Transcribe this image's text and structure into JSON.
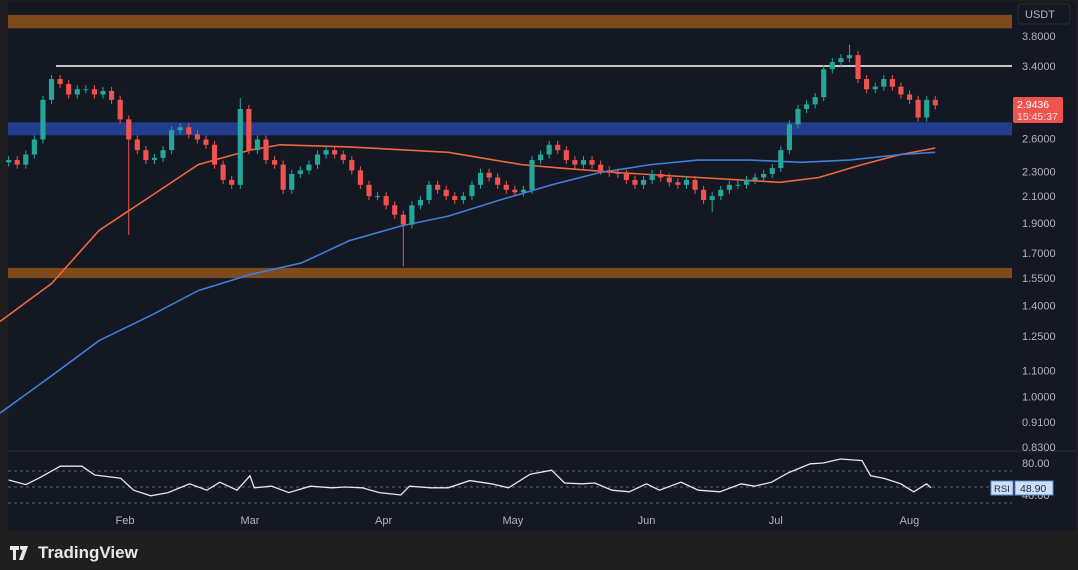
{
  "chart_data": {
    "type": "candlestick",
    "quote_currency": "USDT",
    "price_scale": "log",
    "ylim": [
      0.8,
      4.3
    ],
    "y_ticks": [
      "3.8000",
      "3.4000",
      "2.6000",
      "2.3000",
      "2.1000",
      "1.9000",
      "1.7000",
      "1.5500",
      "1.4000",
      "1.2500",
      "1.1000",
      "1.0000",
      "0.9100",
      "0.8300"
    ],
    "x_ticks": [
      {
        "label": "Feb",
        "day": 29
      },
      {
        "label": "Mar",
        "day": 58
      },
      {
        "label": "Apr",
        "day": 89
      },
      {
        "label": "May",
        "day": 119
      },
      {
        "label": "Jun",
        "day": 150
      },
      {
        "label": "Jul",
        "day": 180
      },
      {
        "label": "Aug",
        "day": 211
      }
    ],
    "day_range": [
      0,
      216
    ],
    "closes": [
      2.4,
      2.36,
      2.45,
      2.59,
      3.0,
      3.24,
      3.18,
      3.06,
      3.12,
      3.12,
      3.06,
      3.1,
      3.0,
      2.79,
      2.59,
      2.49,
      2.4,
      2.42,
      2.49,
      2.68,
      2.71,
      2.64,
      2.59,
      2.54,
      2.36,
      2.23,
      2.19,
      2.9,
      2.49,
      2.59,
      2.4,
      2.36,
      2.15,
      2.28,
      2.31,
      2.36,
      2.45,
      2.49,
      2.45,
      2.4,
      2.31,
      2.19,
      2.1,
      2.1,
      2.03,
      1.96,
      1.89,
      2.03,
      2.07,
      2.19,
      2.15,
      2.1,
      2.07,
      2.1,
      2.19,
      2.29,
      2.25,
      2.19,
      2.15,
      2.13,
      2.15,
      2.4,
      2.45,
      2.54,
      2.49,
      2.4,
      2.36,
      2.4,
      2.36,
      2.31,
      2.29,
      2.28,
      2.23,
      2.19,
      2.23,
      2.28,
      2.25,
      2.21,
      2.19,
      2.23,
      2.15,
      2.07,
      2.1,
      2.15,
      2.19,
      2.19,
      2.23,
      2.25,
      2.28,
      2.33,
      2.49,
      2.74,
      2.9,
      2.95,
      3.03,
      3.36,
      3.45,
      3.5,
      3.54,
      3.24,
      3.12,
      3.15,
      3.24,
      3.15,
      3.06,
      3.0,
      2.81,
      3.0,
      2.94
    ],
    "first_open": 2.38,
    "special_lows": [
      {
        "index": 14,
        "low": 1.82
      },
      {
        "index": 46,
        "low": 1.62
      },
      {
        "index": 82,
        "low": 1.98
      }
    ],
    "special_highs": [
      {
        "index": 27,
        "high": 3.02
      },
      {
        "index": 98,
        "high": 3.68
      }
    ],
    "last_price": "2.9436",
    "countdown": "15:45:37",
    "moving_averages": [
      {
        "name": "MA (orange)",
        "color": "#f0683a",
        "points": [
          [
            0,
            1.32
          ],
          [
            12,
            1.52
          ],
          [
            23,
            1.85
          ],
          [
            35,
            2.1
          ],
          [
            46,
            2.36
          ],
          [
            58,
            2.49
          ],
          [
            65,
            2.54
          ],
          [
            81,
            2.52
          ],
          [
            104,
            2.47
          ],
          [
            121,
            2.36
          ],
          [
            130,
            2.33
          ],
          [
            144,
            2.29
          ],
          [
            162,
            2.25
          ],
          [
            181,
            2.21
          ],
          [
            190,
            2.25
          ],
          [
            200,
            2.36
          ],
          [
            209,
            2.45
          ],
          [
            217,
            2.51
          ]
        ]
      },
      {
        "name": "MA (blue)",
        "color": "#3d7fd9",
        "points": [
          [
            0,
            0.94
          ],
          [
            12,
            1.08
          ],
          [
            23,
            1.23
          ],
          [
            35,
            1.35
          ],
          [
            46,
            1.48
          ],
          [
            58,
            1.57
          ],
          [
            70,
            1.64
          ],
          [
            81,
            1.78
          ],
          [
            93,
            1.88
          ],
          [
            104,
            1.95
          ],
          [
            116,
            2.07
          ],
          [
            128,
            2.19
          ],
          [
            139,
            2.29
          ],
          [
            151,
            2.36
          ],
          [
            162,
            2.4
          ],
          [
            174,
            2.4
          ],
          [
            186,
            2.38
          ],
          [
            197,
            2.4
          ],
          [
            209,
            2.45
          ],
          [
            217,
            2.47
          ]
        ]
      }
    ],
    "zones": [
      {
        "name": "resistance-zone-top",
        "color": "#8a4f1c",
        "from": 3.91,
        "to": 4.11
      },
      {
        "name": "support-zone-blue",
        "color": "#23409a",
        "from": 2.63,
        "to": 2.76
      },
      {
        "name": "support-zone-bottom",
        "color": "#8a4f1c",
        "from": 1.55,
        "to": 1.61
      }
    ],
    "horizontal_line": {
      "price": 3.4,
      "start_day": 13,
      "color": "#ffffff"
    },
    "rsi": {
      "label": "RSI",
      "value": "48.90",
      "levels": [
        70,
        50,
        30
      ],
      "tick_labels": [
        "80.00",
        "40.00"
      ],
      "points": [
        [
          2,
          58.8
        ],
        [
          6,
          53
        ],
        [
          9,
          61
        ],
        [
          14,
          76
        ],
        [
          19,
          76
        ],
        [
          22,
          65
        ],
        [
          28,
          61
        ],
        [
          31,
          46
        ],
        [
          35,
          39
        ],
        [
          39,
          43
        ],
        [
          44,
          54
        ],
        [
          48,
          46
        ],
        [
          51,
          56
        ],
        [
          55,
          46
        ],
        [
          58,
          64
        ],
        [
          59,
          49
        ],
        [
          63,
          51
        ],
        [
          67,
          43
        ],
        [
          72,
          51
        ],
        [
          77,
          49
        ],
        [
          80,
          50
        ],
        [
          84,
          49
        ],
        [
          88,
          43
        ],
        [
          93,
          40
        ],
        [
          95,
          51
        ],
        [
          100,
          49
        ],
        [
          104,
          49
        ],
        [
          109,
          58
        ],
        [
          114,
          54
        ],
        [
          118,
          49
        ],
        [
          123,
          66
        ],
        [
          128,
          71
        ],
        [
          131,
          55
        ],
        [
          135,
          54
        ],
        [
          138,
          55
        ],
        [
          142,
          46
        ],
        [
          146,
          44
        ],
        [
          150,
          54
        ],
        [
          153,
          46
        ],
        [
          158,
          56
        ],
        [
          162,
          46
        ],
        [
          167,
          44
        ],
        [
          172,
          54
        ],
        [
          175,
          51
        ],
        [
          179,
          56
        ],
        [
          183,
          68
        ],
        [
          188,
          79
        ],
        [
          191,
          80
        ],
        [
          195,
          85
        ],
        [
          200,
          83
        ],
        [
          202,
          64
        ],
        [
          205,
          61
        ],
        [
          209,
          54
        ],
        [
          212,
          44
        ],
        [
          215,
          54
        ],
        [
          216,
          49
        ]
      ]
    },
    "colors": {
      "up": "#26a69a",
      "down": "#ef5350",
      "background": "#141823",
      "grid": "#1d2230"
    }
  },
  "branding": {
    "name": "TradingView"
  }
}
